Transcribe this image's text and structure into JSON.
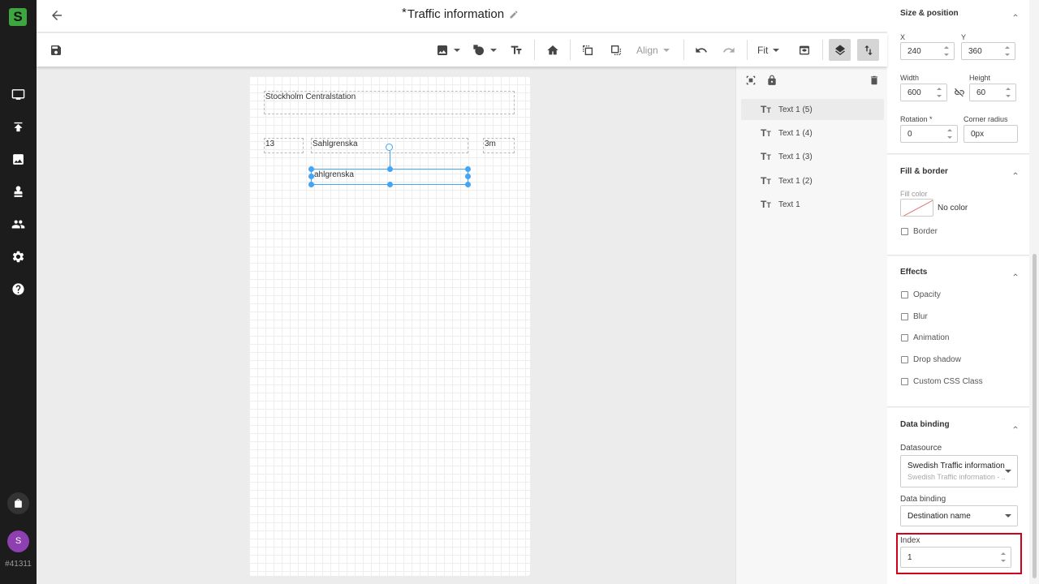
{
  "app": {
    "logo_letter": "S",
    "user_initial": "S",
    "user_id": "#41311"
  },
  "nav": {
    "icons": [
      "monitor-icon",
      "upload-icon",
      "image-icon",
      "stamp-icon",
      "people-icon",
      "gear-icon",
      "help-icon"
    ]
  },
  "header": {
    "title_prefix": "*",
    "title": "Traffic information"
  },
  "toolbar": {
    "align_label": "Align",
    "fit_label": "Fit"
  },
  "canvas": {
    "boxes": [
      {
        "text": "Stockholm Centralstation"
      },
      {
        "text": "13"
      },
      {
        "text": "Sahlgrenska"
      },
      {
        "text": "3m"
      },
      {
        "text": "ahlgrenska"
      }
    ]
  },
  "layers": {
    "items": [
      {
        "label": "Text 1 (5)",
        "active": true
      },
      {
        "label": "Text 1 (4)"
      },
      {
        "label": "Text 1 (3)"
      },
      {
        "label": "Text 1 (2)"
      },
      {
        "label": "Text 1"
      }
    ]
  },
  "props": {
    "size_position": {
      "title": "Size & position",
      "x_label": "X",
      "x": "240",
      "y_label": "Y",
      "y": "360",
      "width_label": "Width",
      "width": "600",
      "height_label": "Height",
      "height": "60",
      "rotation_label": "Rotation *",
      "rotation": "0",
      "radius_label": "Corner radius",
      "radius": "0px"
    },
    "fill_border": {
      "title": "Fill & border",
      "fill_label": "Fill color",
      "fill_value": "No color",
      "border_label": "Border"
    },
    "effects": {
      "title": "Effects",
      "items": [
        "Opacity",
        "Blur",
        "Animation",
        "Drop shadow",
        "Custom CSS Class"
      ]
    },
    "data_binding": {
      "title": "Data binding",
      "datasource_label": "Datasource",
      "datasource_value": "Swedish Traffic information - ...",
      "datasource_sub": "Swedish Traffic information - ...",
      "binding_label": "Data binding",
      "binding_value": "Destination name",
      "index_label": "Index",
      "index_value": "1"
    }
  },
  "colors": {
    "brand": "#3da63f",
    "selection": "#42a5f5",
    "highlight": "#d0021b",
    "avatar": "#8e3fb0"
  }
}
